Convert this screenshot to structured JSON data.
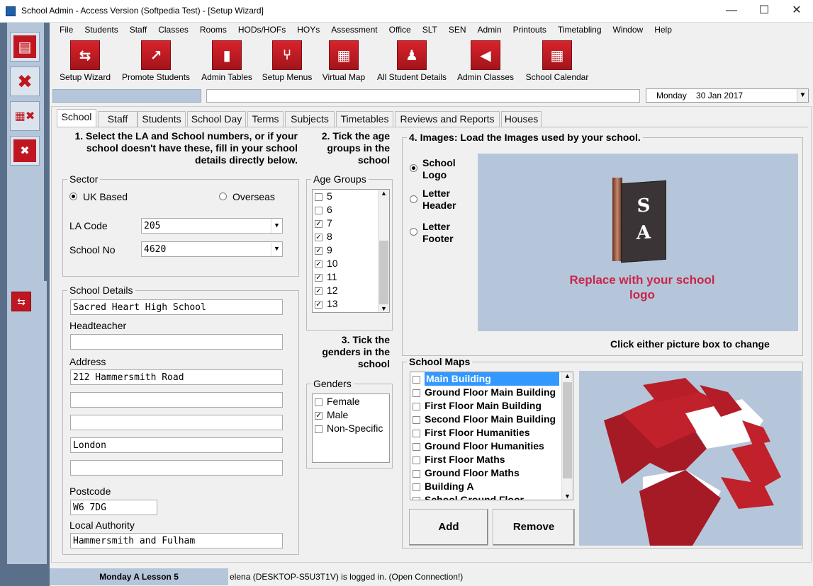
{
  "window": {
    "title": "School Admin - Access Version (Softpedia Test) - [Setup Wizard]",
    "minimize": "—",
    "maximize": "☐",
    "close": "✕"
  },
  "menu": [
    "File",
    "Students",
    "Staff",
    "Classes",
    "Rooms",
    "HODs/HOFs",
    "HOYs",
    "Assessment",
    "Office",
    "SLT",
    "SEN",
    "Admin",
    "Printouts",
    "Timetabling",
    "Window",
    "Help"
  ],
  "toolbar": [
    {
      "label": "Setup Wizard",
      "icon": "signpost-icon"
    },
    {
      "label": "Promote Students",
      "icon": "export-arrow-icon"
    },
    {
      "label": "Admin Tables",
      "icon": "bar-chart-icon"
    },
    {
      "label": "Setup Menus",
      "icon": "flow-icon"
    },
    {
      "label": "Virtual Map",
      "icon": "map-icon"
    },
    {
      "label": "All Student Details",
      "icon": "person-icon"
    },
    {
      "label": "Admin Classes",
      "icon": "back-icon"
    },
    {
      "label": "School Calendar",
      "icon": "calendar-icon"
    }
  ],
  "date": {
    "day": "Monday",
    "value": "30 Jan 2017"
  },
  "tabs": [
    "School",
    "Staff",
    "Students",
    "School Day",
    "Terms",
    "Subjects",
    "Timetables",
    "Reviews and Reports",
    "Houses"
  ],
  "headings": {
    "step1": "1. Select the LA and School numbers, or if your school doesn't have these, fill in your school details directly below.",
    "step2": "2. Tick the age groups in the school",
    "step3": "3. Tick the genders in the school",
    "step4": "4. Images: Load the Images used by your school."
  },
  "sector": {
    "legend": "Sector",
    "uk": "UK Based",
    "overseas": "Overseas",
    "la_label": "LA Code",
    "la_value": "205",
    "school_label": "School No",
    "school_value": "4620"
  },
  "details": {
    "legend": "School Details",
    "name": "Sacred Heart High School",
    "headteacher_label": "Headteacher",
    "headteacher": "",
    "address_label": "Address",
    "address1": "212 Hammersmith Road",
    "address2": "",
    "address3": "",
    "address4": "London",
    "address5": "",
    "postcode_label": "Postcode",
    "postcode": "W6 7DG",
    "authority_label": "Local Authority",
    "authority": "Hammersmith and Fulham"
  },
  "age_groups": {
    "legend": "Age Groups",
    "items": [
      {
        "label": "5",
        "checked": false
      },
      {
        "label": "6",
        "checked": false
      },
      {
        "label": "7",
        "checked": true
      },
      {
        "label": "8",
        "checked": true
      },
      {
        "label": "9",
        "checked": true
      },
      {
        "label": "10",
        "checked": true
      },
      {
        "label": "11",
        "checked": true
      },
      {
        "label": "12",
        "checked": true
      },
      {
        "label": "13",
        "checked": true
      }
    ]
  },
  "genders": {
    "legend": "Genders",
    "items": [
      {
        "label": "Female",
        "checked": false
      },
      {
        "label": "Male",
        "checked": true
      },
      {
        "label": "Non-Specific",
        "checked": false
      }
    ]
  },
  "images": {
    "logo": "School Logo",
    "letter_header": "Letter Header",
    "letter_footer": "Letter Footer",
    "placeholder": "Replace with your school logo",
    "logo_letters": "S A",
    "hint": "Click either picture box to change"
  },
  "maps": {
    "legend": "School Maps",
    "items": [
      "Main Building",
      "Ground Floor Main Building",
      "First Floor Main Building",
      "Second Floor Main Building",
      "First Floor Humanities",
      "Ground Floor Humanities",
      "First Floor Maths",
      "Ground Floor Maths",
      "Building A",
      "School Ground Floor"
    ],
    "add": "Add",
    "remove": "Remove"
  },
  "status": {
    "lesson": "Monday A Lesson 5",
    "user": "elena (DESKTOP-S5U3T1V) is logged in. (Open Connection!)"
  },
  "colors": {
    "accent": "#c0161f",
    "panel": "#b6c6da",
    "selected": "#3399ff",
    "logo_text": "#c8264a"
  }
}
